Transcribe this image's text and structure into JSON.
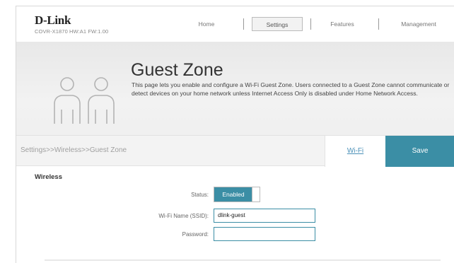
{
  "header": {
    "logo": "D-Link",
    "firmware": "COVR-X1870 HW:A1 FW:1.00",
    "nav": [
      "Home",
      "Settings",
      "Features",
      "Management"
    ],
    "active_nav": "Settings"
  },
  "hero": {
    "title": "Guest Zone",
    "description": "This page lets you enable and configure a Wi-Fi Guest Zone. Users connected to a Guest Zone cannot communicate or detect devices on your home network unless Internet Access Only is disabled under Home Network Access.",
    "icon": "two-users-icon"
  },
  "breadcrumb": "Settings>>Wireless>>Guest Zone",
  "actions": {
    "wifi_link": "Wi-Fi",
    "save": "Save"
  },
  "form": {
    "section_title": "Wireless",
    "status_label": "Status:",
    "status_value": "Enabled",
    "ssid_label": "Wi-Fi Name (SSID):",
    "ssid_value": "dlink-guest",
    "password_label": "Password:",
    "password_value": ""
  },
  "colors": {
    "accent": "#3b8ea5",
    "link": "#4a90b8"
  }
}
